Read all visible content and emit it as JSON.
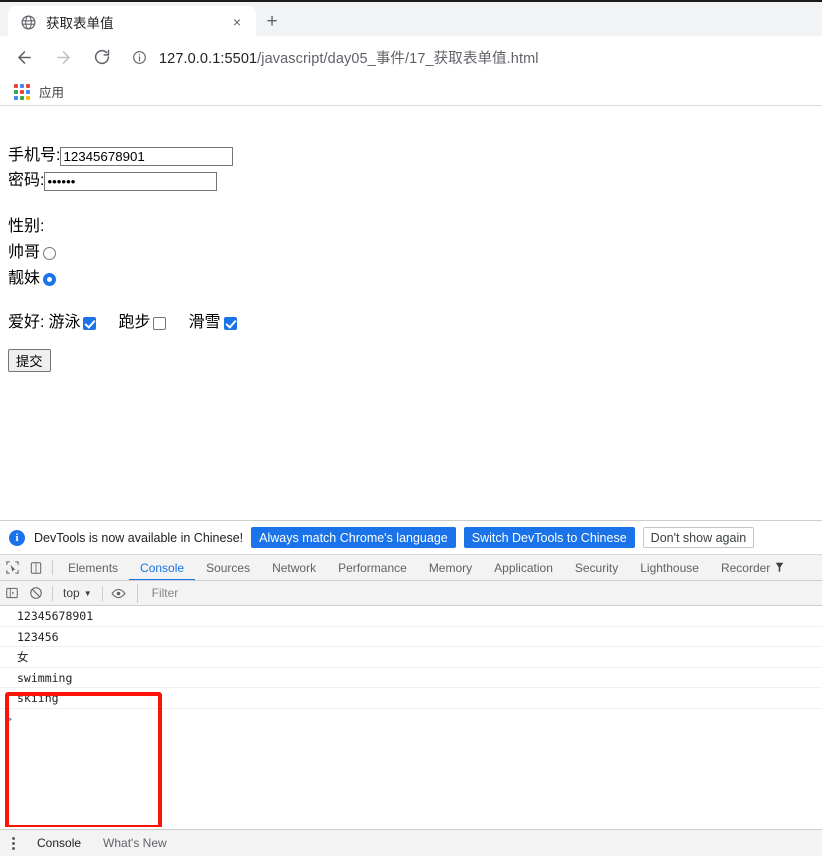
{
  "browser": {
    "tab": {
      "title": "获取表单值",
      "favicon": "globe-icon",
      "close": "×"
    },
    "new_tab_label": "+",
    "nav": {
      "back": "←",
      "forward": "→",
      "reload": "⟳"
    },
    "omnibox": {
      "info_icon": "info-circle-icon",
      "url_host": "127.0.0.1:5501",
      "url_path": "/javascript/day05_事件/17_获取表单值.html",
      "url_full": "127.0.0.1:5501/javascript/day05_事件/17_获取表单值.html"
    },
    "bookmarks": {
      "apps_label": "应用",
      "apps_icon": "apps-grid-icon"
    }
  },
  "page": {
    "phone": {
      "label": "手机号:",
      "value": "12345678901",
      "placeholder": ""
    },
    "password": {
      "label": "密码:",
      "value": "123456",
      "placeholder": ""
    },
    "gender": {
      "label": "性别:",
      "options": [
        {
          "label": "帅哥",
          "checked": false
        },
        {
          "label": "靓妹",
          "checked": true
        }
      ]
    },
    "hobby": {
      "label": "爱好:",
      "options": [
        {
          "label": "游泳",
          "checked": true
        },
        {
          "label": "跑步",
          "checked": false
        },
        {
          "label": "滑雪",
          "checked": true
        }
      ]
    },
    "submit_label": "提交"
  },
  "devtools": {
    "notice": {
      "icon": "info-icon",
      "text": "DevTools is now available in Chinese!",
      "buttons": [
        {
          "label": "Always match Chrome's language",
          "style": "primary"
        },
        {
          "label": "Switch DevTools to Chinese",
          "style": "primary"
        },
        {
          "label": "Don't show again",
          "style": "ghost"
        }
      ]
    },
    "toolbar_icons": {
      "inspect": "inspect-cursor-icon",
      "device": "device-toolbar-icon"
    },
    "tabs": [
      {
        "label": "Elements",
        "active": false
      },
      {
        "label": "Console",
        "active": true
      },
      {
        "label": "Sources",
        "active": false
      },
      {
        "label": "Network",
        "active": false
      },
      {
        "label": "Performance",
        "active": false
      },
      {
        "label": "Memory",
        "active": false
      },
      {
        "label": "Application",
        "active": false
      },
      {
        "label": "Security",
        "active": false
      },
      {
        "label": "Lighthouse",
        "active": false
      },
      {
        "label": "Recorder",
        "active": false
      }
    ],
    "console_bar": {
      "sidebar_icon": "console-sidebar-icon",
      "clear_icon": "clear-console-icon",
      "context": "top",
      "context_caret": "▼",
      "eye_icon": "live-expression-eye-icon",
      "filter_placeholder": "Filter",
      "filter_value": ""
    },
    "console_messages": [
      "12345678901",
      "123456",
      "女",
      "swimming",
      "skiing"
    ],
    "prompt_symbol": ">",
    "annotation": {
      "shape": "rectangle",
      "color": "#fb1405"
    },
    "drawer": {
      "menu_icon": "more-vertical-icon",
      "tabs": [
        {
          "label": "Console",
          "active": true
        },
        {
          "label": "What's New",
          "active": false
        }
      ]
    }
  },
  "colors": {
    "accent_blue": "#1a73e8",
    "annotation_red": "#fb1405",
    "chrome_gray": "#f1f3f4",
    "devtools_gray": "#f3f3f3"
  }
}
